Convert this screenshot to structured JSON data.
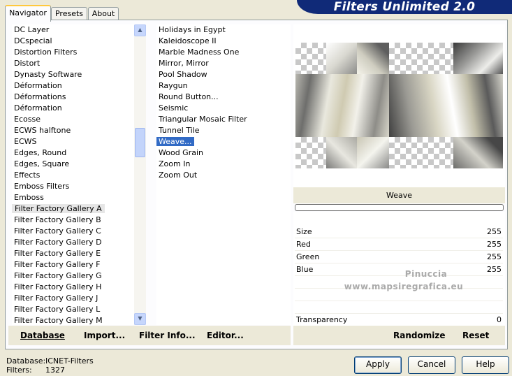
{
  "header": {
    "title": "Filters Unlimited 2.0"
  },
  "tabs": [
    {
      "label": "Navigator"
    },
    {
      "label": "Presets"
    },
    {
      "label": "About"
    }
  ],
  "categories": {
    "items": [
      "DC Layer",
      "DCspecial",
      "Distortion Filters",
      "Distort",
      "Dynasty Software",
      "Déformation",
      "Déformations",
      "Déformation",
      "Ecosse",
      "ECWS halftone",
      "ECWS",
      "Edges, Round",
      "Edges, Square",
      "Effects",
      "Emboss Filters",
      "Emboss",
      "Filter Factory Gallery A",
      "Filter Factory Gallery B",
      "Filter Factory Gallery C",
      "Filter Factory Gallery D",
      "Filter Factory Gallery E",
      "Filter Factory Gallery F",
      "Filter Factory Gallery G",
      "Filter Factory Gallery H",
      "Filter Factory Gallery J",
      "Filter Factory Gallery L",
      "Filter Factory Gallery M"
    ],
    "selected": "Filter Factory Gallery A"
  },
  "filters": {
    "items": [
      "Holidays in Egypt",
      "Kaleidoscope II",
      "Marble Madness One",
      "Mirror, Mirror",
      "Pool Shadow",
      "Raygun",
      "Round Button...",
      "Seismic",
      "Triangular Mosaic Filter",
      "Tunnel Tile",
      "Weave...",
      "Wood Grain",
      "Zoom In",
      "Zoom Out"
    ],
    "selected": "Weave..."
  },
  "preview": {
    "filter_name": "Weave"
  },
  "params": [
    {
      "label": "Size",
      "value": "255"
    },
    {
      "label": "Red",
      "value": "255"
    },
    {
      "label": "Green",
      "value": "255"
    },
    {
      "label": "Blue",
      "value": "255"
    }
  ],
  "transparency": {
    "label": "Transparency",
    "value": "0"
  },
  "watermark": {
    "line1": "Pinuccia",
    "line2": "www.mapsiregrafica.eu"
  },
  "toolbar": {
    "database": "Database",
    "import": "Import...",
    "filter_info": "Filter Info...",
    "editor": "Editor...",
    "randomize": "Randomize",
    "reset": "Reset"
  },
  "footer": {
    "database_label": "Database:",
    "database_value": "ICNET-Filters",
    "filters_label": "Filters:",
    "filters_value": "1327"
  },
  "buttons": {
    "apply": "Apply",
    "cancel": "Cancel",
    "help": "Help"
  },
  "colors": {
    "header_bg": "#102a78",
    "selection": "#316ac5",
    "tab_accent": "#ffc83c"
  }
}
